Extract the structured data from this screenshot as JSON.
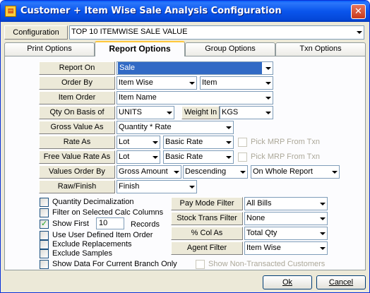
{
  "window": {
    "title": "Customer + Item Wise Sale  Analysis Configuration",
    "close_glyph": "✕",
    "app_icon": "report-app-icon"
  },
  "configuration": {
    "label": "Configuration",
    "value": "TOP 10 ITEMWISE SALE VALUE"
  },
  "tabs": [
    {
      "label": "Print Options",
      "active": false
    },
    {
      "label": "Report Options",
      "active": true
    },
    {
      "label": "Group Options",
      "active": false
    },
    {
      "label": "Txn Options",
      "active": false
    }
  ],
  "report_options": {
    "report_on": {
      "label": "Report On",
      "value": "Sale"
    },
    "order_by": {
      "label": "Order By",
      "value1": "Item Wise",
      "value2": "Item"
    },
    "item_order": {
      "label": "Item Order",
      "value": "Item Name"
    },
    "qty_basis": {
      "label": "Qty On Basis of",
      "value": "UNITS",
      "weight_label": "Weight In",
      "weight_value": "KGS"
    },
    "gross_value": {
      "label": "Gross Value As",
      "value": "Quantity * Rate"
    },
    "rate_as": {
      "label": "Rate As",
      "value1": "Lot",
      "value2": "Basic Rate",
      "mrp_label": "Pick MRP From Txn"
    },
    "free_rate_as": {
      "label": "Free Value Rate As",
      "value1": "Lot",
      "value2": "Basic Rate",
      "mrp_label": "Pick MRP From Txn"
    },
    "values_order_by": {
      "label": "Values Order By",
      "value1": "Gross Amount",
      "value2": "Descending",
      "value3": "On Whole Report"
    },
    "raw_finish": {
      "label": "Raw/Finish",
      "value": "Finish"
    }
  },
  "checkboxes": {
    "quantity_decimalization": {
      "label": "Quantity Decimalization",
      "checked": false
    },
    "filter_calc_columns": {
      "label": "Filter on Selected Calc Columns",
      "checked": false
    },
    "show_first": {
      "label": "Show First",
      "checked": true,
      "count": "10",
      "suffix": "Records"
    },
    "user_defined_order": {
      "label": "Use User Defined Item Order",
      "checked": false
    },
    "exclude_replacements": {
      "label": "Exclude Replacements",
      "checked": false
    },
    "exclude_samples": {
      "label": "Exclude Samples",
      "checked": false
    },
    "current_branch": {
      "label": "Show Data For Current Branch Only",
      "checked": false
    },
    "non_transacted": {
      "label": "Show Non-Transacted Customers",
      "checked": false
    }
  },
  "filters": {
    "pay_mode": {
      "label": "Pay Mode Filter",
      "value": "All Bills"
    },
    "stock_trans": {
      "label": "Stock Trans Filter",
      "value": "None"
    },
    "pct_col": {
      "label": "% Col As",
      "value": "Total Qty"
    },
    "agent": {
      "label": "Agent Filter",
      "value": "Item Wise"
    }
  },
  "buttons": {
    "ok": "Ok",
    "cancel": "Cancel"
  },
  "colors": {
    "titlebar": "#0a55ec",
    "dialog_bg": "#ece9d8",
    "selection": "#316ac5",
    "tab_highlight": "#ffc83c"
  }
}
